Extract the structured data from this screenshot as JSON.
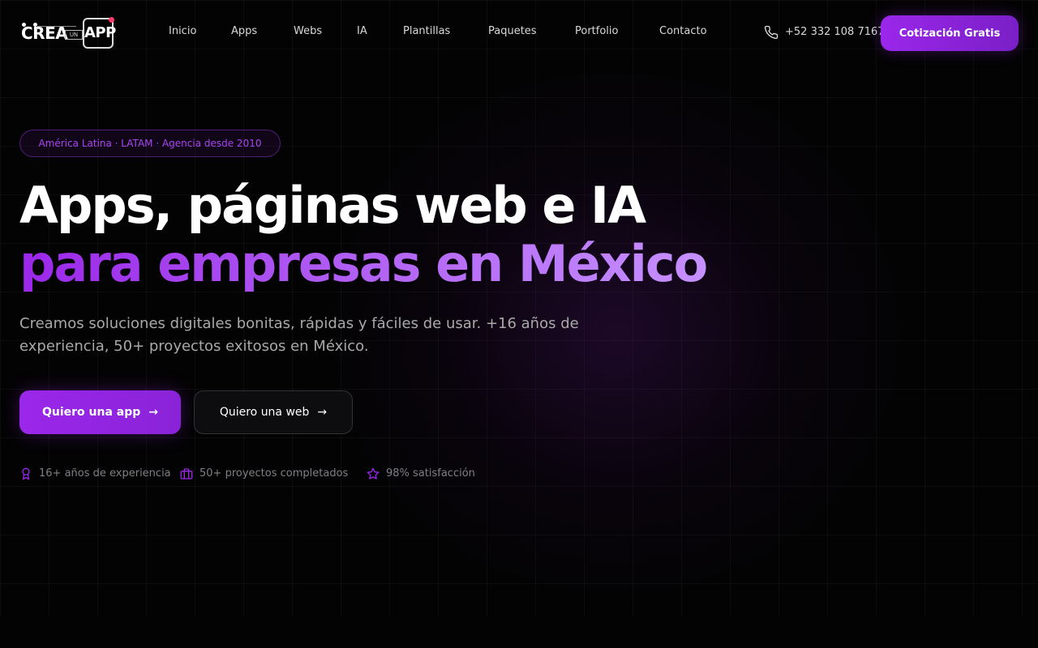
{
  "brand": {
    "logo_text_left": "CREA",
    "logo_text_mid": "UN",
    "logo_text_right": "APP",
    "accent": "#9b27ea",
    "dot_color": "#ff3b6b"
  },
  "nav": {
    "items": [
      "Inicio",
      "Apps",
      "Webs",
      "IA",
      "Plantillas",
      "Paquetes",
      "Portfolio",
      "Contacto"
    ]
  },
  "header": {
    "phone_icon": "phone-icon",
    "phone": "+52 332 108 7167",
    "cta_label": "Cotización Gratis"
  },
  "hero": {
    "badge": "América Latina · LATAM · Agencia desde 2010",
    "title_line1": "Apps, páginas web e IA",
    "title_line2": "para empresas en México",
    "subtitle": "Creamos soluciones digitales bonitas, rápidas y fáciles de usar. +16 años de experiencia, 50+ proyectos exitosos en México.",
    "primary_button": "Quiero una app",
    "secondary_button": "Quiero una web",
    "arrow": "→"
  },
  "stats": [
    {
      "icon": "award-icon",
      "label": "16+ años de experiencia"
    },
    {
      "icon": "briefcase-icon",
      "label": "50+ proyectos completados"
    },
    {
      "icon": "star-icon",
      "label": "98% satisfacción"
    }
  ]
}
